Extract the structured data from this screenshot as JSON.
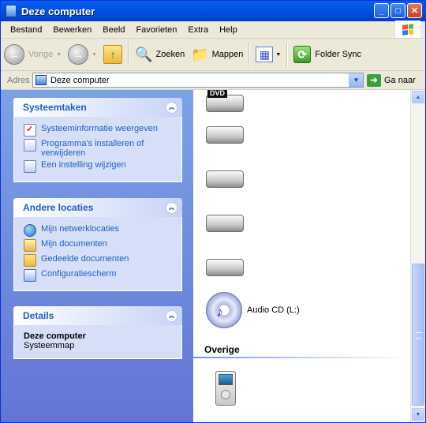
{
  "window": {
    "title": "Deze computer"
  },
  "titlebar_buttons": {
    "minimize": "_",
    "maximize": "□",
    "close": "✕"
  },
  "menu": [
    "Bestand",
    "Bewerken",
    "Beeld",
    "Favorieten",
    "Extra",
    "Help"
  ],
  "toolbar": {
    "back_label": "Vorige",
    "search_label": "Zoeken",
    "folders_label": "Mappen",
    "foldersync_label": "Folder Sync",
    "back_icon": "←",
    "forward_icon": "→",
    "up_icon": "↑",
    "search_icon": "🔍",
    "folders_icon": "📁",
    "views_icon": "▦",
    "foldersync_icon": "⟳"
  },
  "address": {
    "label": "Adres",
    "value": "Deze computer",
    "go_label": "Ga naar",
    "go_icon": "➜"
  },
  "taskpane": {
    "system": {
      "title": "Systeemtaken",
      "items": [
        "Systeeminformatie weergeven",
        "Programma's installeren of verwijderen",
        "Een instelling wijzigen"
      ]
    },
    "other": {
      "title": "Andere locaties",
      "items": [
        "Mijn netwerklocaties",
        "Mijn documenten",
        "Gedeelde documenten",
        "Configuratiescherm"
      ]
    },
    "details": {
      "title": "Details",
      "name": "Deze computer",
      "type": "Systeemmap"
    },
    "collapse_icon": "︽"
  },
  "content": {
    "dvd_badge": "DVD",
    "audio_cd_label": "Audio CD (L:)",
    "cd_icon": "♪",
    "group_other": "Overige"
  },
  "scrollbar": {
    "up_icon": "▲",
    "down_icon": "▼"
  }
}
